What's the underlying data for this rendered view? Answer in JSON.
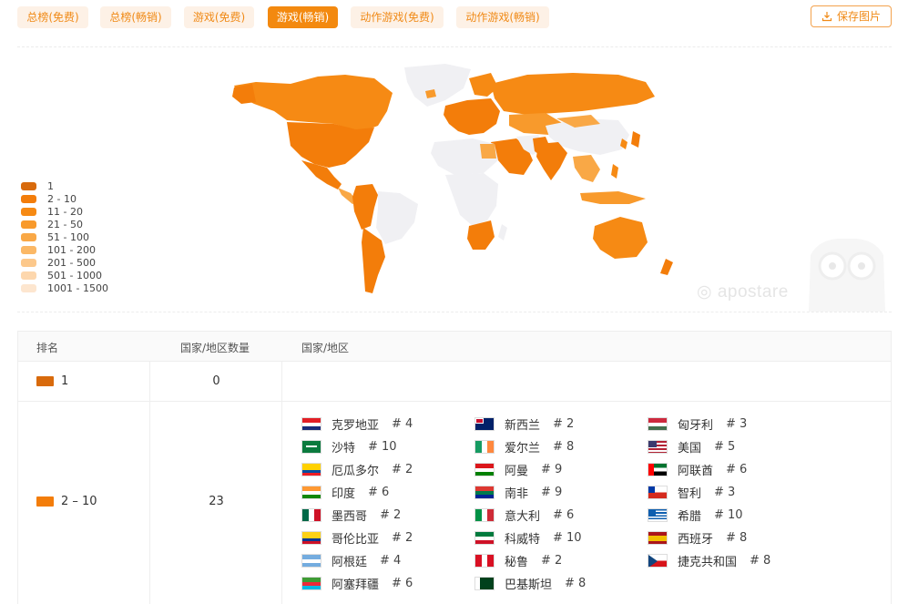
{
  "tabs": [
    {
      "label": "总榜(免费)",
      "active": false
    },
    {
      "label": "总榜(畅销)",
      "active": false
    },
    {
      "label": "游戏(免费)",
      "active": false
    },
    {
      "label": "游戏(畅销)",
      "active": true
    },
    {
      "label": "动作游戏(免费)",
      "active": false
    },
    {
      "label": "动作游戏(畅销)",
      "active": false
    }
  ],
  "save_button": {
    "label": "保存图片",
    "icon": "download-icon"
  },
  "legend": [
    {
      "label": "1",
      "color": "#d86a0c"
    },
    {
      "label": "2 - 10",
      "color": "#f37d0a"
    },
    {
      "label": "11 - 20",
      "color": "#f68a14"
    },
    {
      "label": "21 - 50",
      "color": "#f89a2c"
    },
    {
      "label": "51 - 100",
      "color": "#f9a846"
    },
    {
      "label": "101 - 200",
      "color": "#fbb866"
    },
    {
      "label": "201 - 500",
      "color": "#fcc88b"
    },
    {
      "label": "501 - 1000",
      "color": "#fdd7ad"
    },
    {
      "label": "1001 - 1500",
      "color": "#fde6cf"
    }
  ],
  "watermark": "apostare",
  "table": {
    "headers": {
      "rank": "排名",
      "count": "国家/地区数量",
      "countries": "国家/地区"
    },
    "rows": [
      {
        "rank": "1",
        "color": "#d86a0c",
        "count": "0",
        "countries": []
      },
      {
        "rank": "2 – 10",
        "color": "#f37d0a",
        "count": "23",
        "countries": [
          {
            "name": "克罗地亚",
            "rank": "# 4",
            "flag": "croatia"
          },
          {
            "name": "沙特",
            "rank": "# 10",
            "flag": "saudi"
          },
          {
            "name": "厄瓜多尔",
            "rank": "# 2",
            "flag": "ecuador"
          },
          {
            "name": "印度",
            "rank": "# 6",
            "flag": "india"
          },
          {
            "name": "墨西哥",
            "rank": "# 2",
            "flag": "mexico"
          },
          {
            "name": "哥伦比亚",
            "rank": "# 2",
            "flag": "colombia"
          },
          {
            "name": "阿根廷",
            "rank": "# 4",
            "flag": "argentina"
          },
          {
            "name": "阿塞拜疆",
            "rank": "# 6",
            "flag": "azerbaijan"
          },
          {
            "name": "新西兰",
            "rank": "# 2",
            "flag": "newzealand"
          },
          {
            "name": "爱尔兰",
            "rank": "# 8",
            "flag": "ireland"
          },
          {
            "name": "阿曼",
            "rank": "# 9",
            "flag": "oman"
          },
          {
            "name": "南非",
            "rank": "# 9",
            "flag": "southafrica"
          },
          {
            "name": "意大利",
            "rank": "# 6",
            "flag": "italy"
          },
          {
            "name": "科威特",
            "rank": "# 10",
            "flag": "kuwait"
          },
          {
            "name": "秘鲁",
            "rank": "# 2",
            "flag": "peru"
          },
          {
            "name": "巴基斯坦",
            "rank": "# 8",
            "flag": "pakistan"
          },
          {
            "name": "匈牙利",
            "rank": "# 3",
            "flag": "hungary"
          },
          {
            "name": "美国",
            "rank": "# 5",
            "flag": "usa"
          },
          {
            "name": "阿联酋",
            "rank": "# 6",
            "flag": "uae"
          },
          {
            "name": "智利",
            "rank": "# 3",
            "flag": "chile"
          },
          {
            "name": "希腊",
            "rank": "# 10",
            "flag": "greece"
          },
          {
            "name": "西班牙",
            "rank": "# 8",
            "flag": "spain"
          },
          {
            "name": "捷克共和国",
            "rank": "# 8",
            "flag": "czech"
          }
        ]
      }
    ]
  }
}
